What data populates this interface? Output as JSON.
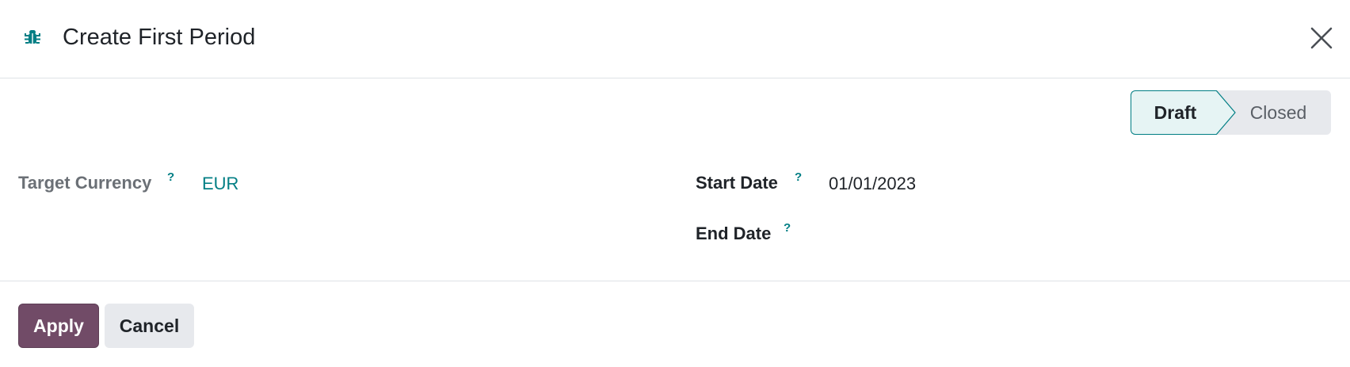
{
  "dialog": {
    "title": "Create First Period",
    "icons": {
      "app": "bug-icon",
      "close": "close-icon"
    },
    "colors": {
      "accent": "#017e84",
      "primary_button": "#714b67",
      "secondary_button": "#e7e9ed",
      "active_stage_bg": "#e6f4f4"
    }
  },
  "statusbar": {
    "stages": [
      {
        "label": "Draft",
        "active": true
      },
      {
        "label": "Closed",
        "active": false
      }
    ]
  },
  "fields": {
    "target_currency": {
      "label": "Target Currency",
      "help": "?",
      "value": "EUR"
    },
    "start_date": {
      "label": "Start Date",
      "help": "?",
      "value": "01/01/2023"
    },
    "end_date": {
      "label": "End Date",
      "help": "?",
      "value": ""
    }
  },
  "footer": {
    "apply_label": "Apply",
    "cancel_label": "Cancel"
  }
}
